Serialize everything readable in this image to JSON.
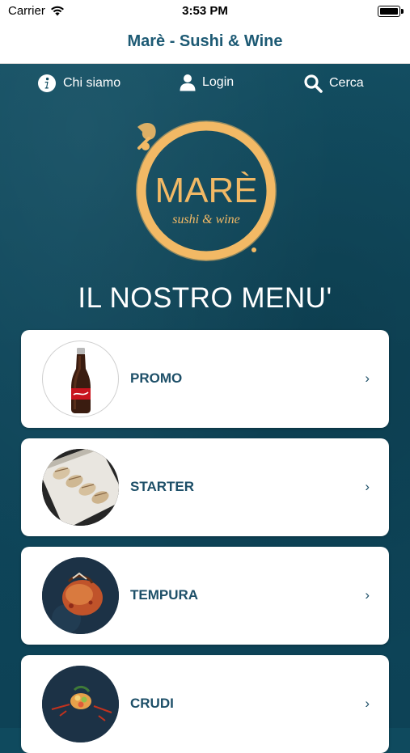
{
  "status_bar": {
    "carrier": "Carrier",
    "time": "3:53 PM"
  },
  "nav": {
    "title": "Marè - Sushi & Wine"
  },
  "top_links": [
    {
      "label": "Chi siamo",
      "icon": "info-icon"
    },
    {
      "label": "Login",
      "icon": "user-icon"
    },
    {
      "label": "Cerca",
      "icon": "search-icon"
    }
  ],
  "logo": {
    "main": "MARÈ",
    "sub": "sushi & wine"
  },
  "menu_title": "IL NOSTRO MENU'",
  "categories": [
    {
      "label": "PROMO",
      "chevron": "›"
    },
    {
      "label": "STARTER",
      "chevron": "›"
    },
    {
      "label": "TEMPURA",
      "chevron": "›"
    },
    {
      "label": "CRUDI",
      "chevron": "›"
    }
  ],
  "colors": {
    "accent": "#1d5a74",
    "background": "#0f4a5e",
    "logo": "#f2b965"
  }
}
